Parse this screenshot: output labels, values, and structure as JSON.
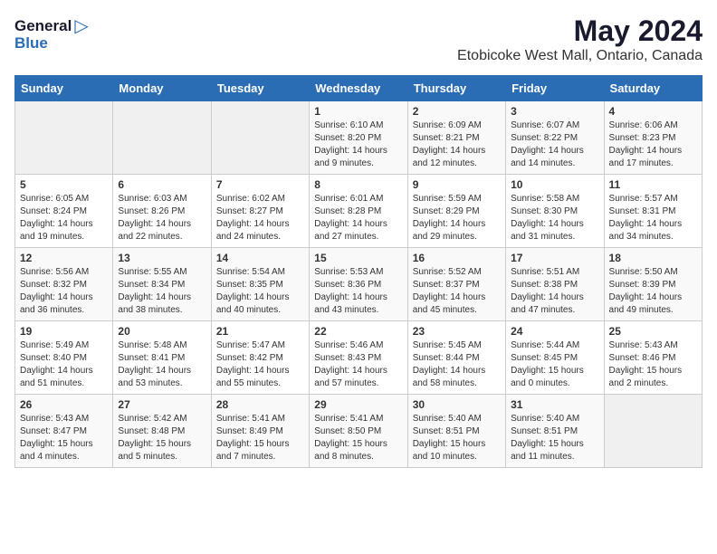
{
  "header": {
    "logo_general": "General",
    "logo_blue": "Blue",
    "title": "May 2024",
    "subtitle": "Etobicoke West Mall, Ontario, Canada"
  },
  "calendar": {
    "days_of_week": [
      "Sunday",
      "Monday",
      "Tuesday",
      "Wednesday",
      "Thursday",
      "Friday",
      "Saturday"
    ],
    "weeks": [
      [
        {
          "day": "",
          "info": ""
        },
        {
          "day": "",
          "info": ""
        },
        {
          "day": "",
          "info": ""
        },
        {
          "day": "1",
          "info": "Sunrise: 6:10 AM\nSunset: 8:20 PM\nDaylight: 14 hours\nand 9 minutes."
        },
        {
          "day": "2",
          "info": "Sunrise: 6:09 AM\nSunset: 8:21 PM\nDaylight: 14 hours\nand 12 minutes."
        },
        {
          "day": "3",
          "info": "Sunrise: 6:07 AM\nSunset: 8:22 PM\nDaylight: 14 hours\nand 14 minutes."
        },
        {
          "day": "4",
          "info": "Sunrise: 6:06 AM\nSunset: 8:23 PM\nDaylight: 14 hours\nand 17 minutes."
        }
      ],
      [
        {
          "day": "5",
          "info": "Sunrise: 6:05 AM\nSunset: 8:24 PM\nDaylight: 14 hours\nand 19 minutes."
        },
        {
          "day": "6",
          "info": "Sunrise: 6:03 AM\nSunset: 8:26 PM\nDaylight: 14 hours\nand 22 minutes."
        },
        {
          "day": "7",
          "info": "Sunrise: 6:02 AM\nSunset: 8:27 PM\nDaylight: 14 hours\nand 24 minutes."
        },
        {
          "day": "8",
          "info": "Sunrise: 6:01 AM\nSunset: 8:28 PM\nDaylight: 14 hours\nand 27 minutes."
        },
        {
          "day": "9",
          "info": "Sunrise: 5:59 AM\nSunset: 8:29 PM\nDaylight: 14 hours\nand 29 minutes."
        },
        {
          "day": "10",
          "info": "Sunrise: 5:58 AM\nSunset: 8:30 PM\nDaylight: 14 hours\nand 31 minutes."
        },
        {
          "day": "11",
          "info": "Sunrise: 5:57 AM\nSunset: 8:31 PM\nDaylight: 14 hours\nand 34 minutes."
        }
      ],
      [
        {
          "day": "12",
          "info": "Sunrise: 5:56 AM\nSunset: 8:32 PM\nDaylight: 14 hours\nand 36 minutes."
        },
        {
          "day": "13",
          "info": "Sunrise: 5:55 AM\nSunset: 8:34 PM\nDaylight: 14 hours\nand 38 minutes."
        },
        {
          "day": "14",
          "info": "Sunrise: 5:54 AM\nSunset: 8:35 PM\nDaylight: 14 hours\nand 40 minutes."
        },
        {
          "day": "15",
          "info": "Sunrise: 5:53 AM\nSunset: 8:36 PM\nDaylight: 14 hours\nand 43 minutes."
        },
        {
          "day": "16",
          "info": "Sunrise: 5:52 AM\nSunset: 8:37 PM\nDaylight: 14 hours\nand 45 minutes."
        },
        {
          "day": "17",
          "info": "Sunrise: 5:51 AM\nSunset: 8:38 PM\nDaylight: 14 hours\nand 47 minutes."
        },
        {
          "day": "18",
          "info": "Sunrise: 5:50 AM\nSunset: 8:39 PM\nDaylight: 14 hours\nand 49 minutes."
        }
      ],
      [
        {
          "day": "19",
          "info": "Sunrise: 5:49 AM\nSunset: 8:40 PM\nDaylight: 14 hours\nand 51 minutes."
        },
        {
          "day": "20",
          "info": "Sunrise: 5:48 AM\nSunset: 8:41 PM\nDaylight: 14 hours\nand 53 minutes."
        },
        {
          "day": "21",
          "info": "Sunrise: 5:47 AM\nSunset: 8:42 PM\nDaylight: 14 hours\nand 55 minutes."
        },
        {
          "day": "22",
          "info": "Sunrise: 5:46 AM\nSunset: 8:43 PM\nDaylight: 14 hours\nand 57 minutes."
        },
        {
          "day": "23",
          "info": "Sunrise: 5:45 AM\nSunset: 8:44 PM\nDaylight: 14 hours\nand 58 minutes."
        },
        {
          "day": "24",
          "info": "Sunrise: 5:44 AM\nSunset: 8:45 PM\nDaylight: 15 hours\nand 0 minutes."
        },
        {
          "day": "25",
          "info": "Sunrise: 5:43 AM\nSunset: 8:46 PM\nDaylight: 15 hours\nand 2 minutes."
        }
      ],
      [
        {
          "day": "26",
          "info": "Sunrise: 5:43 AM\nSunset: 8:47 PM\nDaylight: 15 hours\nand 4 minutes."
        },
        {
          "day": "27",
          "info": "Sunrise: 5:42 AM\nSunset: 8:48 PM\nDaylight: 15 hours\nand 5 minutes."
        },
        {
          "day": "28",
          "info": "Sunrise: 5:41 AM\nSunset: 8:49 PM\nDaylight: 15 hours\nand 7 minutes."
        },
        {
          "day": "29",
          "info": "Sunrise: 5:41 AM\nSunset: 8:50 PM\nDaylight: 15 hours\nand 8 minutes."
        },
        {
          "day": "30",
          "info": "Sunrise: 5:40 AM\nSunset: 8:51 PM\nDaylight: 15 hours\nand 10 minutes."
        },
        {
          "day": "31",
          "info": "Sunrise: 5:40 AM\nSunset: 8:51 PM\nDaylight: 15 hours\nand 11 minutes."
        },
        {
          "day": "",
          "info": ""
        }
      ]
    ]
  }
}
